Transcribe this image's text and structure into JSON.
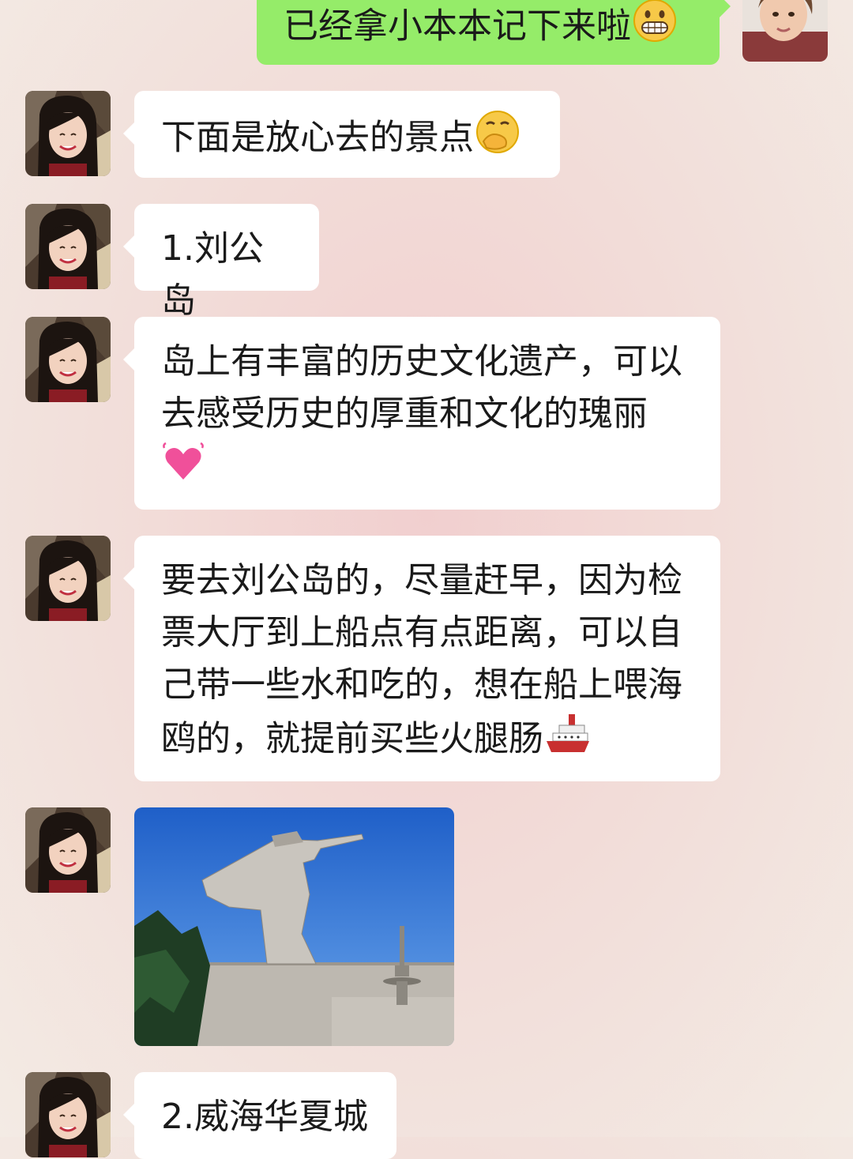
{
  "messages": {
    "sent_1": {
      "text": "已经拿小本本记下来啦",
      "emoji": "grinning-face-icon"
    },
    "msg_1": {
      "text": "下面是放心去的景点",
      "emoji": "thinking-hand-over-mouth-icon"
    },
    "msg_2": {
      "text": "1.刘公岛"
    },
    "msg_3": {
      "text": "岛上有丰富的历史文化遗产，可以去感受历史的厚重和文化的瑰丽",
      "emoji": "beating-heart-icon"
    },
    "msg_4": {
      "text": "要去刘公岛的，尽量赶早，因为检票大厅到上船点有点距离，可以自己带一些水和吃的，想在船上喂海鸥的，就提前买些火腿肠",
      "emoji": "ship-icon"
    },
    "msg_5": {
      "image": "statue-photo"
    },
    "msg_6": {
      "text": "2.威海华夏城"
    }
  },
  "colors": {
    "sent_bubble": "#95ec69",
    "received_bubble": "#ffffff",
    "background": "#f2dcd8"
  }
}
